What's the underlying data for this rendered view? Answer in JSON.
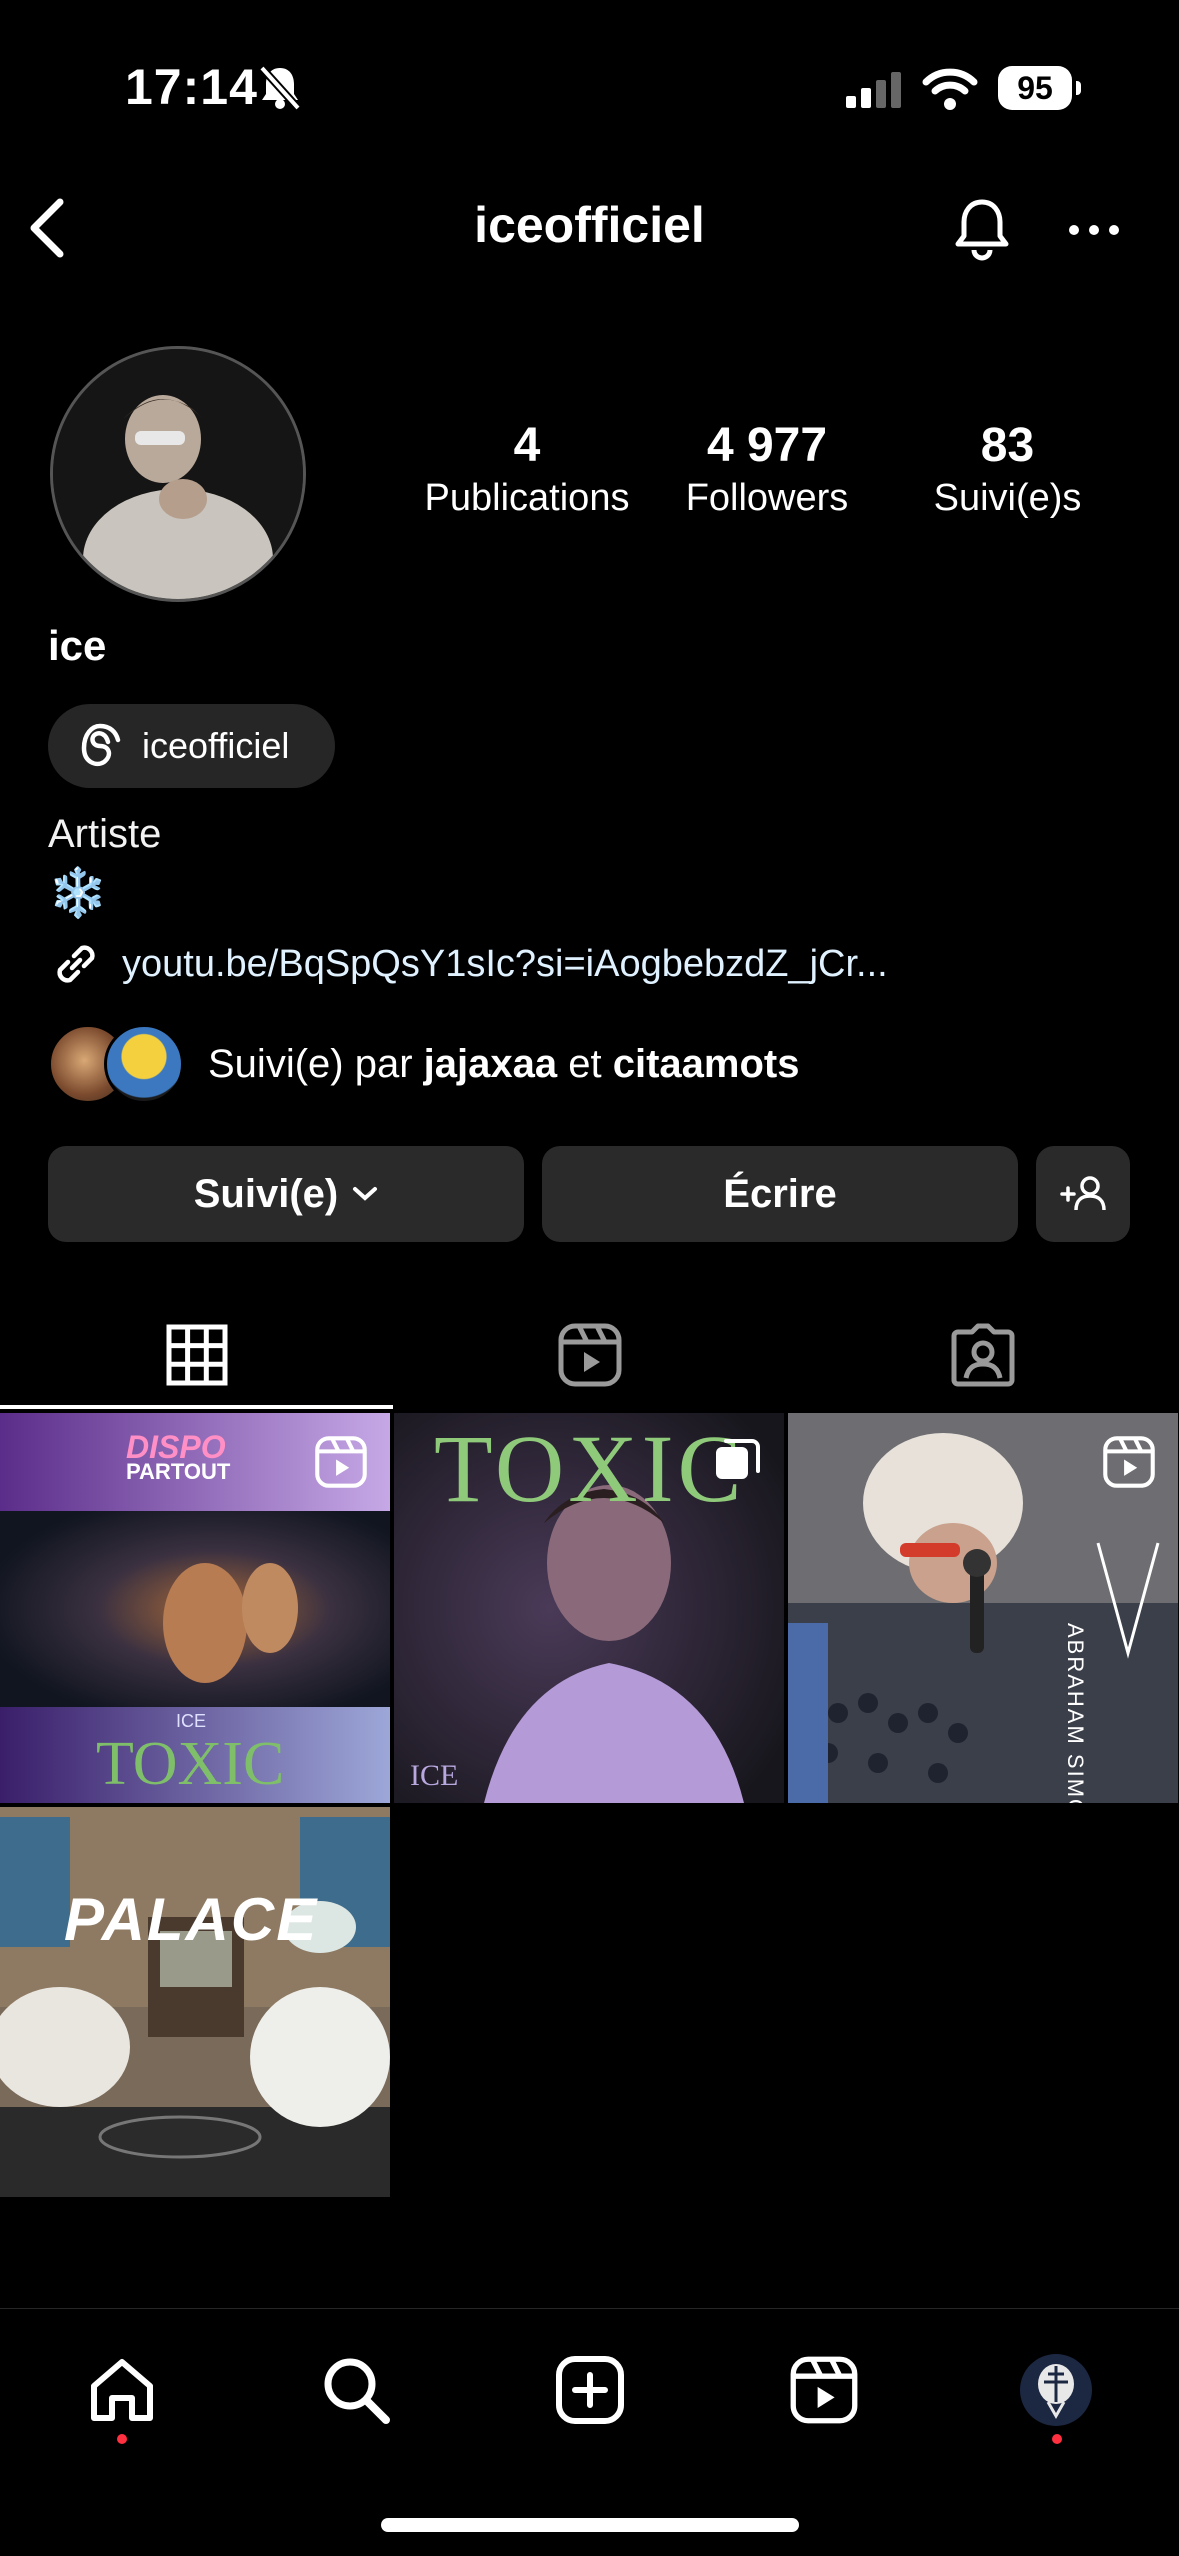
{
  "status_bar": {
    "time": "17:14",
    "battery": "95"
  },
  "header": {
    "title": "iceofficiel"
  },
  "profile": {
    "name": "ice",
    "threads_handle": "iceofficiel",
    "category": "Artiste",
    "bio_emoji": "❄️",
    "link": "youtu.be/BqSpQsY1sIc?si=iAogbebzdZ_jCr...",
    "stats": [
      {
        "value": "4",
        "label": "Publications"
      },
      {
        "value": "4 977",
        "label": "Followers"
      },
      {
        "value": "83",
        "label": "Suivi(e)s"
      }
    ],
    "followed_by": {
      "prefix": "Suivi(e) par",
      "user1": "jajaxaa",
      "connector": "et",
      "user2": "citaamots"
    }
  },
  "actions": {
    "following_label": "Suivi(e)",
    "message_label": "Écrire"
  },
  "grid": {
    "posts": [
      {
        "top_title": "DISPO",
        "top_subtitle": "PARTOUT",
        "bottom_small": "ICE",
        "bottom_title": "TOXIC",
        "type": "reel"
      },
      {
        "title": "TOXIC",
        "caption": "ICE",
        "type": "carousel"
      },
      {
        "side_text": "ABRAHAM SIMON",
        "type": "reel"
      },
      {
        "title": "PALACE",
        "type": "image"
      }
    ]
  },
  "colors": {
    "background": "#000000",
    "button_bg": "#2a2a2a",
    "notification_dot": "#ff3040",
    "toxic_green": "#7fbf6a"
  }
}
